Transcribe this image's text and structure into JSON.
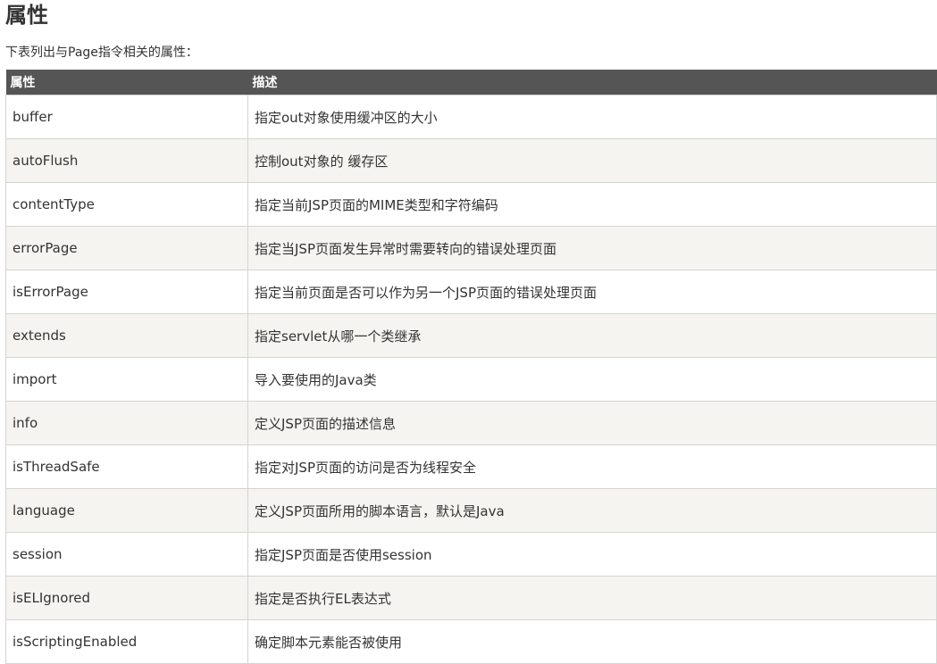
{
  "heading": "属性",
  "intro": "下表列出与Page指令相关的属性：",
  "table": {
    "headers": [
      "属性",
      "描述"
    ],
    "rows": [
      {
        "name": "buffer",
        "desc": "指定out对象使用缓冲区的大小"
      },
      {
        "name": "autoFlush",
        "desc": "控制out对象的 缓存区"
      },
      {
        "name": "contentType",
        "desc": "指定当前JSP页面的MIME类型和字符编码"
      },
      {
        "name": "errorPage",
        "desc": "指定当JSP页面发生异常时需要转向的错误处理页面"
      },
      {
        "name": "isErrorPage",
        "desc": "指定当前页面是否可以作为另一个JSP页面的错误处理页面"
      },
      {
        "name": "extends",
        "desc": "指定servlet从哪一个类继承"
      },
      {
        "name": "import",
        "desc": "导入要使用的Java类"
      },
      {
        "name": "info",
        "desc": "定义JSP页面的描述信息"
      },
      {
        "name": "isThreadSafe",
        "desc": "指定对JSP页面的访问是否为线程安全"
      },
      {
        "name": "language",
        "desc": "定义JSP页面所用的脚本语言，默认是Java"
      },
      {
        "name": "session",
        "desc": "指定JSP页面是否使用session"
      },
      {
        "name": "isELIgnored",
        "desc": "指定是否执行EL表达式"
      },
      {
        "name": "isScriptingEnabled",
        "desc": "确定脚本元素能否被使用"
      }
    ]
  },
  "colors": {
    "header_bg": "#555555",
    "header_text": "#ffffff",
    "row_alt_bg": "#f6f4f0",
    "border": "#d4d4d4",
    "text": "#333333"
  }
}
